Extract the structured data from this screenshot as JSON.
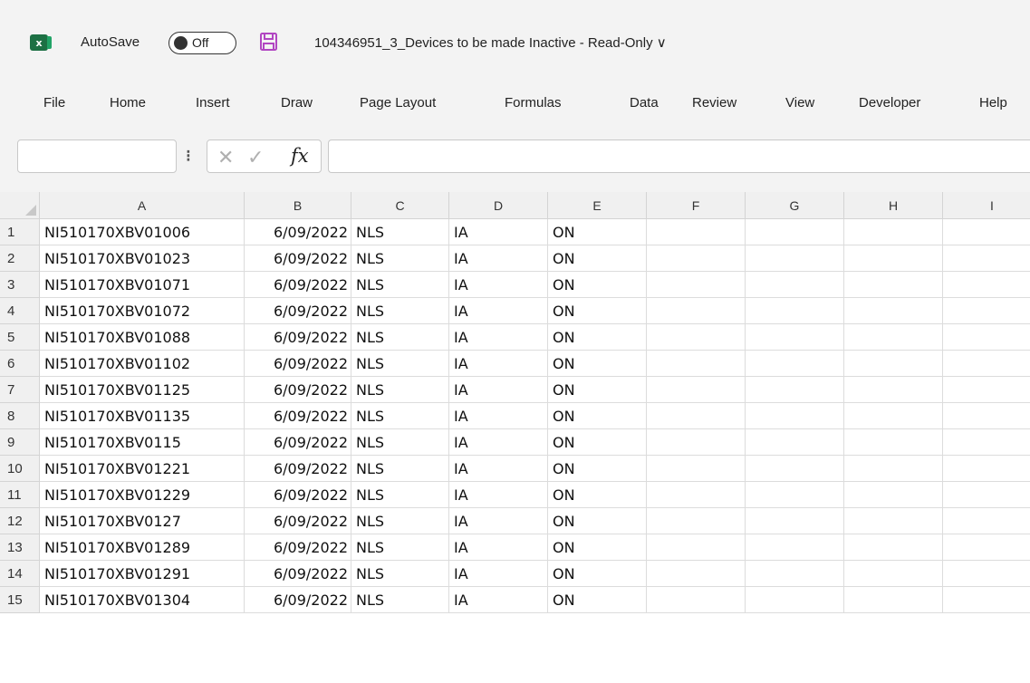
{
  "titlebar": {
    "autosave_label": "AutoSave",
    "autosave_state": "Off",
    "document_title": "104346951_3_Devices to be made Inactive  -  Read-Only",
    "dropdown_glyph": "∨",
    "logo_letter": "x"
  },
  "ribbon": {
    "tabs": [
      "File",
      "Home",
      "Insert",
      "Draw",
      "Page Layout",
      "Formulas",
      "Data",
      "Review",
      "View",
      "Developer",
      "Help"
    ]
  },
  "formula_bar": {
    "name_box_value": "",
    "separator": "⁝",
    "cancel_glyph": "✕",
    "enter_glyph": "✓",
    "fx_label": "fx",
    "formula_value": ""
  },
  "sheet": {
    "columns": [
      "A",
      "B",
      "C",
      "D",
      "E",
      "F",
      "G",
      "H",
      "I"
    ],
    "rows": [
      {
        "num": "1",
        "cells": [
          "NI510170XBV01006",
          "6/09/2022",
          "NLS",
          "IA",
          "ON"
        ]
      },
      {
        "num": "2",
        "cells": [
          "NI510170XBV01023",
          "6/09/2022",
          "NLS",
          "IA",
          "ON"
        ]
      },
      {
        "num": "3",
        "cells": [
          "NI510170XBV01071",
          "6/09/2022",
          "NLS",
          "IA",
          "ON"
        ]
      },
      {
        "num": "4",
        "cells": [
          "NI510170XBV01072",
          "6/09/2022",
          "NLS",
          "IA",
          "ON"
        ]
      },
      {
        "num": "5",
        "cells": [
          "NI510170XBV01088",
          "6/09/2022",
          "NLS",
          "IA",
          "ON"
        ]
      },
      {
        "num": "6",
        "cells": [
          "NI510170XBV01102",
          "6/09/2022",
          "NLS",
          "IA",
          "ON"
        ]
      },
      {
        "num": "7",
        "cells": [
          "NI510170XBV01125",
          "6/09/2022",
          "NLS",
          "IA",
          "ON"
        ]
      },
      {
        "num": "8",
        "cells": [
          "NI510170XBV01135",
          "6/09/2022",
          "NLS",
          "IA",
          "ON"
        ]
      },
      {
        "num": "9",
        "cells": [
          "NI510170XBV0115",
          "6/09/2022",
          "NLS",
          "IA",
          "ON"
        ]
      },
      {
        "num": "10",
        "cells": [
          "NI510170XBV01221",
          "6/09/2022",
          "NLS",
          "IA",
          "ON"
        ]
      },
      {
        "num": "11",
        "cells": [
          "NI510170XBV01229",
          "6/09/2022",
          "NLS",
          "IA",
          "ON"
        ]
      },
      {
        "num": "12",
        "cells": [
          "NI510170XBV0127",
          "6/09/2022",
          "NLS",
          "IA",
          "ON"
        ]
      },
      {
        "num": "13",
        "cells": [
          "NI510170XBV01289",
          "6/09/2022",
          "NLS",
          "IA",
          "ON"
        ]
      },
      {
        "num": "14",
        "cells": [
          "NI510170XBV01291",
          "6/09/2022",
          "NLS",
          "IA",
          "ON"
        ]
      },
      {
        "num": "15",
        "cells": [
          "NI510170XBV01304",
          "6/09/2022",
          "NLS",
          "IA",
          "ON"
        ]
      }
    ]
  },
  "colors": {
    "excel_green": "#1d7044",
    "save_icon": "#b146c2",
    "chrome_bg": "#f3f3f3",
    "header_bg": "#f0f0f0",
    "gridline": "#dcdcdc"
  }
}
